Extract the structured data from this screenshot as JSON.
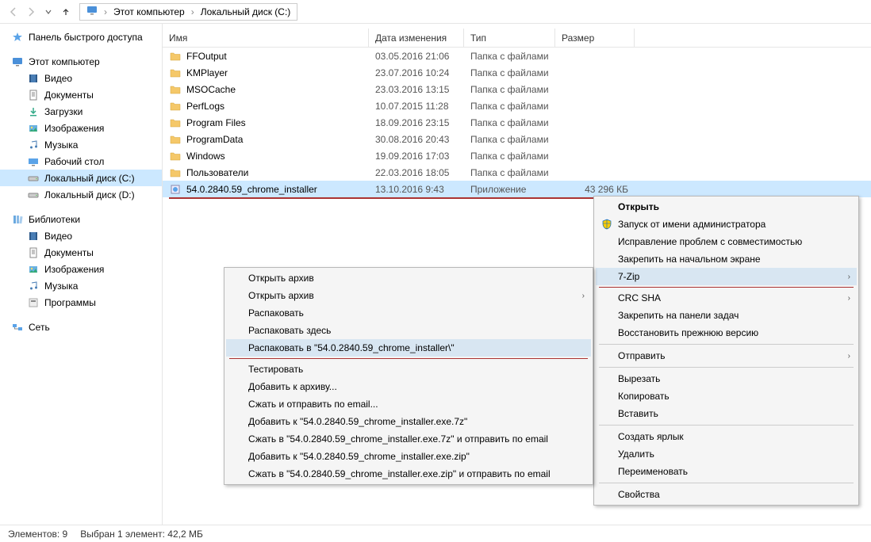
{
  "breadcrumb": {
    "root": "Этот компьютер",
    "drive": "Локальный диск (C:)"
  },
  "sidebar": {
    "quick": "Панель быстрого доступа",
    "thispc": "Этот компьютер",
    "thispc_items": [
      "Видео",
      "Документы",
      "Загрузки",
      "Изображения",
      "Музыка",
      "Рабочий стол",
      "Локальный диск (C:)",
      "Локальный диск (D:)"
    ],
    "libraries": "Библиотеки",
    "lib_items": [
      "Видео",
      "Документы",
      "Изображения",
      "Музыка",
      "Программы"
    ],
    "network": "Сеть"
  },
  "columns": {
    "name": "Имя",
    "date": "Дата изменения",
    "type": "Тип",
    "size": "Размер"
  },
  "files": [
    {
      "name": "FFOutput",
      "date": "03.05.2016 21:06",
      "type": "Папка с файлами",
      "size": "",
      "icon": "folder"
    },
    {
      "name": "KMPlayer",
      "date": "23.07.2016 10:24",
      "type": "Папка с файлами",
      "size": "",
      "icon": "folder"
    },
    {
      "name": "MSOCache",
      "date": "23.03.2016 13:15",
      "type": "Папка с файлами",
      "size": "",
      "icon": "folder"
    },
    {
      "name": "PerfLogs",
      "date": "10.07.2015 11:28",
      "type": "Папка с файлами",
      "size": "",
      "icon": "folder"
    },
    {
      "name": "Program Files",
      "date": "18.09.2016 23:15",
      "type": "Папка с файлами",
      "size": "",
      "icon": "folder"
    },
    {
      "name": "ProgramData",
      "date": "30.08.2016 20:43",
      "type": "Папка с файлами",
      "size": "",
      "icon": "folder"
    },
    {
      "name": "Windows",
      "date": "19.09.2016 17:03",
      "type": "Папка с файлами",
      "size": "",
      "icon": "folder"
    },
    {
      "name": "Пользователи",
      "date": "22.03.2016 18:05",
      "type": "Папка с файлами",
      "size": "",
      "icon": "folder"
    },
    {
      "name": "54.0.2840.59_chrome_installer",
      "date": "13.10.2016 9:43",
      "type": "Приложение",
      "size": "43 296 КБ",
      "icon": "exe",
      "selected": true
    }
  ],
  "ctx_main": {
    "open": "Открыть",
    "runas": "Запуск от имени администратора",
    "compat": "Исправление проблем с совместимостью",
    "pinstart": "Закрепить на начальном экране",
    "sevenzip": "7-Zip",
    "crc": "CRC SHA",
    "pintask": "Закрепить на панели задач",
    "restore": "Восстановить прежнюю версию",
    "sendto": "Отправить",
    "cut": "Вырезать",
    "copy": "Копировать",
    "paste": "Вставить",
    "shortcut": "Создать ярлык",
    "delete": "Удалить",
    "rename": "Переименовать",
    "props": "Свойства"
  },
  "ctx_7zip": [
    "Открыть архив",
    "Открыть архив",
    "Распаковать",
    "Распаковать здесь",
    "Распаковать в \"54.0.2840.59_chrome_installer\\\"",
    "Тестировать",
    "Добавить к архиву...",
    "Сжать и отправить по email...",
    "Добавить к \"54.0.2840.59_chrome_installer.exe.7z\"",
    "Сжать в \"54.0.2840.59_chrome_installer.exe.7z\" и отправить по email",
    "Добавить к \"54.0.2840.59_chrome_installer.exe.zip\"",
    "Сжать в \"54.0.2840.59_chrome_installer.exe.zip\" и отправить по email"
  ],
  "status": {
    "count": "Элементов: 9",
    "sel": "Выбран 1 элемент: 42,2 МБ"
  }
}
